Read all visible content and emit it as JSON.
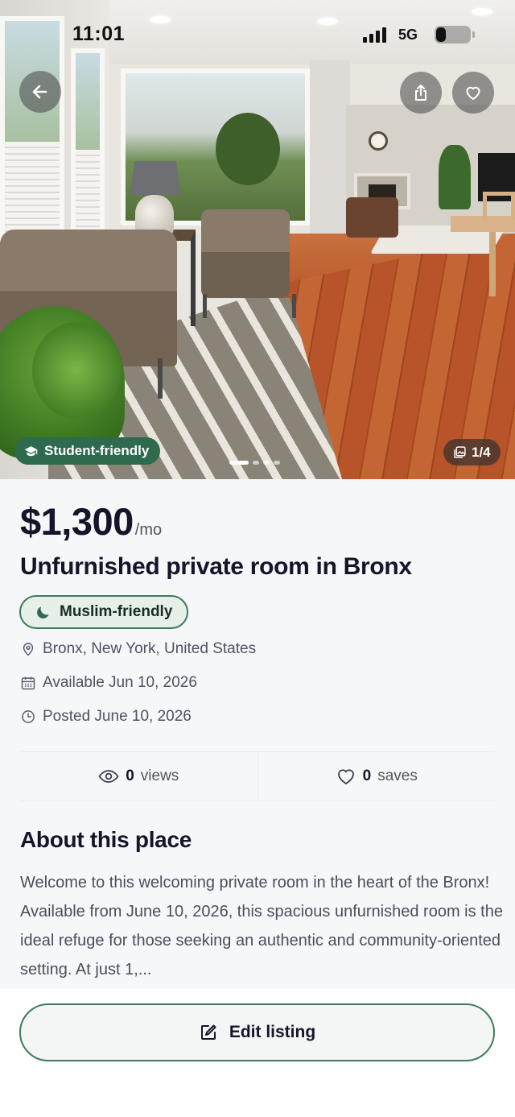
{
  "status_bar": {
    "time": "11:01",
    "network": "5G"
  },
  "hero": {
    "student_badge": "Student-friendly",
    "photo_counter": "1/4",
    "photos_total": 4,
    "current_photo": 1
  },
  "listing": {
    "price": "$1,300",
    "price_unit": "/mo",
    "title": "Unfurnished private room in Bronx",
    "tag": "Muslim-friendly",
    "location": "Bronx, New York, United States",
    "available": "Available Jun 10, 2026",
    "posted": "Posted June 10, 2026"
  },
  "stats": {
    "views_count": "0",
    "views_label": "views",
    "saves_count": "0",
    "saves_label": "saves"
  },
  "about": {
    "heading": "About this place",
    "text": "Welcome to this welcoming private room in the heart of the Bronx! Available from June 10, 2026, this spacious unfurnished room is the ideal refuge for those seeking an authentic and community-oriented setting. At just 1,..."
  },
  "actions": {
    "edit_label": "Edit listing"
  },
  "colors": {
    "accent_green": "#2e6a4e",
    "badge_border": "#3e7b5c",
    "text_dark": "#14152a"
  }
}
